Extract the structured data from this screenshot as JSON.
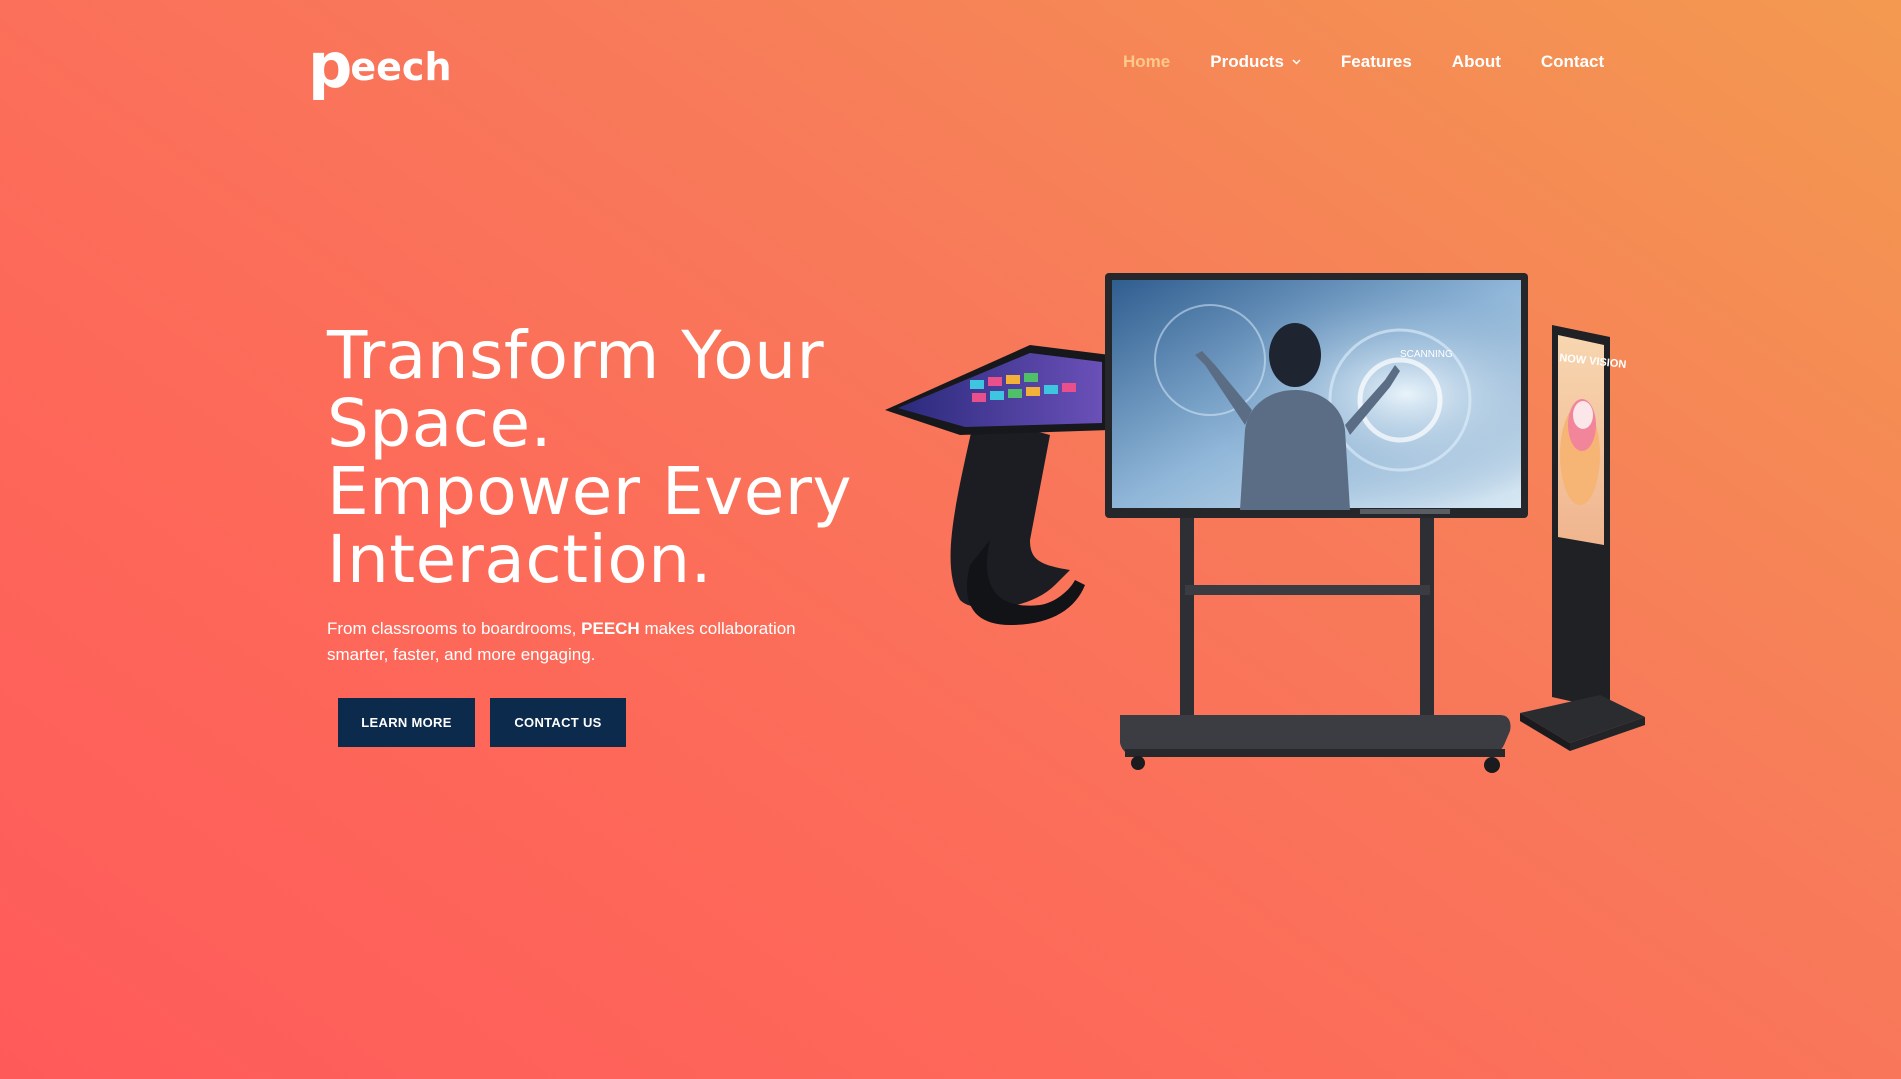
{
  "brand": {
    "logo_first": "p",
    "logo_rest": "eech",
    "accent_color": "#ffc98a",
    "button_color": "#0c2a4c"
  },
  "nav": {
    "items": [
      {
        "label": "Home",
        "active": true
      },
      {
        "label": "Products",
        "has_dropdown": true
      },
      {
        "label": "Features"
      },
      {
        "label": "About"
      },
      {
        "label": "Contact"
      }
    ]
  },
  "hero": {
    "title_lines": [
      "Transform Your",
      "Space.",
      "Empower Every",
      "Interaction."
    ],
    "subtitle_before": "From classrooms to boardrooms, ",
    "subtitle_brand": "PEECH",
    "subtitle_after": " makes collaboration smarter, faster, and more engaging.",
    "learn_more": "LEARN MORE",
    "contact_us": "CONTACT US"
  },
  "product_image": {
    "screen_text": "SCANNING",
    "kiosk_text": "NOW VISION"
  }
}
